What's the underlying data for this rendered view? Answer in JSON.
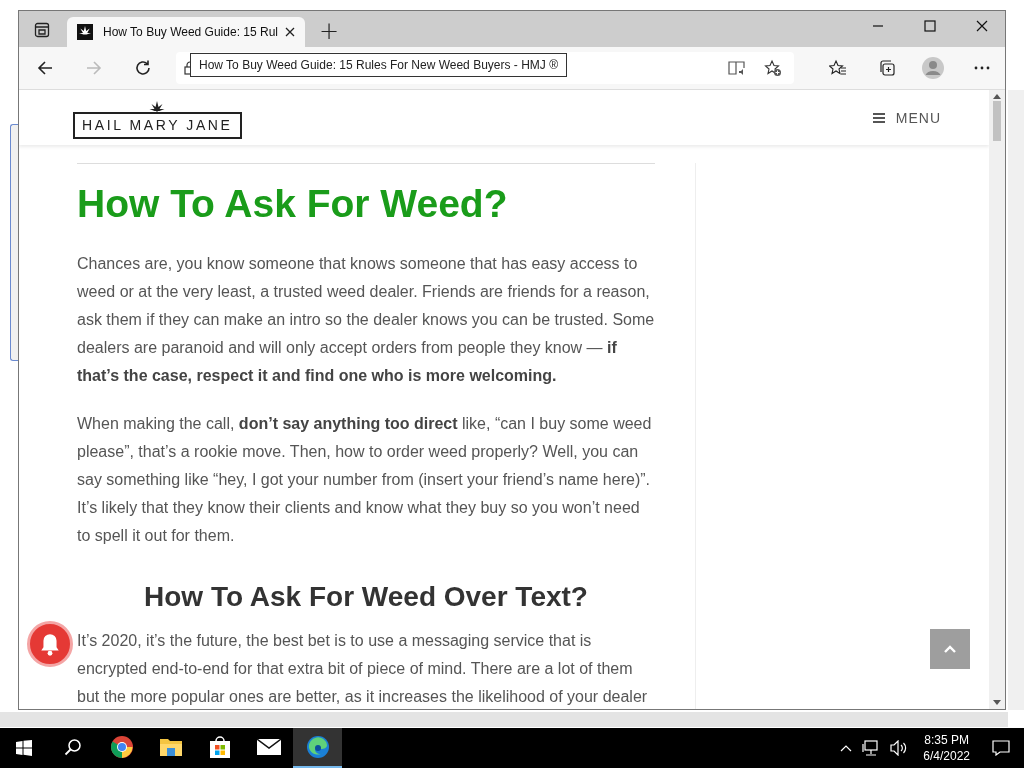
{
  "browser": {
    "tabs": [
      {
        "title": "How To Buy Weed Guide: 15 Rul",
        "selected": true
      }
    ],
    "new_tab": "+",
    "tooltip": "How To Buy Weed Guide: 15 Rules For New Weed Buyers - HMJ ®"
  },
  "site_header": {
    "logo": "HAIL MARY JANE",
    "menu": "MENU"
  },
  "article": [
    {
      "kind": "heading",
      "text": "How To Ask For Weed?"
    },
    {
      "kind": "paragraph",
      "text": "Chances are, you know someone that knows someone that has easy access to weed or at the very least, a trusted weed dealer. Friends are friends for a reason, ask them if they can make an intro so the dealer knows you can be trusted. Some dealers are paranoid and will only accept orders from people they know — **if that’s the case, respect it and find one who is more welcoming.**"
    },
    {
      "kind": "paragraph",
      "text": "When making the call, **don’t say anything too direct** like, “can I buy some weed please”, that’s a rookie move. Then, how to order weed properly? Well, you can say something like “hey, I got your number from (insert your friend’s name here)”. It’s likely that they know their clients and know what they buy so you won’t need to spell it out for them."
    },
    {
      "kind": "subheading",
      "text": "How To Ask For Weed Over Text?"
    },
    {
      "kind": "paragraph",
      "text": "It’s 2020, it’s the future, the best bet is to use a messaging service that is encrypted end-to-end for that extra bit of piece of mind. There are a lot of them but the more popular ones are better, as it increases the likelihood of your dealer"
    }
  ],
  "taskbar": {
    "apps": [
      {
        "kind": "search",
        "selected": false
      },
      {
        "kind": "chrome",
        "selected": false
      },
      {
        "kind": "files",
        "selected": false
      },
      {
        "kind": "store",
        "selected": false
      },
      {
        "kind": "mail",
        "selected": false
      },
      {
        "kind": "edge",
        "selected": true
      }
    ],
    "clock": {
      "time": "8:35 PM",
      "date": "6/4/2022"
    }
  }
}
